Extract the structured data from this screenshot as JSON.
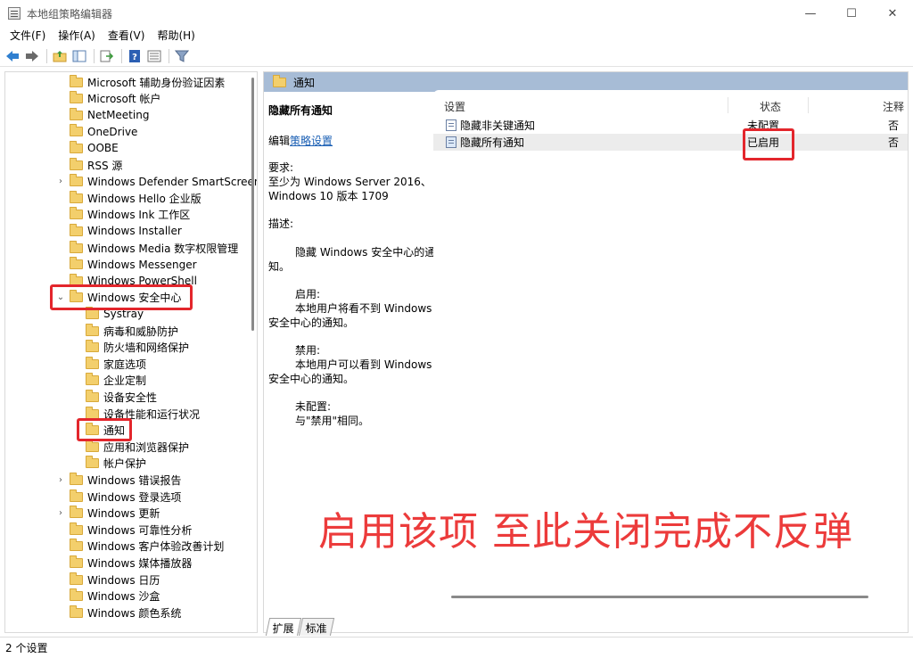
{
  "window": {
    "title": "本地组策略编辑器",
    "controls": {
      "minimize": "—",
      "maximize": "☐",
      "close": "✕"
    }
  },
  "menu": [
    "文件(F)",
    "操作(A)",
    "查看(V)",
    "帮助(H)"
  ],
  "toolbar": {
    "buttons": [
      "back-icon",
      "forward-icon",
      "up-folder-icon",
      "show-hide-tree-icon",
      "export-list-icon",
      "help-icon",
      "properties-icon",
      "filter-icon"
    ]
  },
  "tree": {
    "items": [
      {
        "label": "Microsoft 辅助身份验证因素",
        "level": 1,
        "chevron": ""
      },
      {
        "label": "Microsoft 帐户",
        "level": 1,
        "chevron": ""
      },
      {
        "label": "NetMeeting",
        "level": 1,
        "chevron": ""
      },
      {
        "label": "OneDrive",
        "level": 1,
        "chevron": ""
      },
      {
        "label": "OOBE",
        "level": 1,
        "chevron": ""
      },
      {
        "label": "RSS 源",
        "level": 1,
        "chevron": ""
      },
      {
        "label": "Windows Defender SmartScreen",
        "level": 1,
        "chevron": "›"
      },
      {
        "label": "Windows Hello 企业版",
        "level": 1,
        "chevron": ""
      },
      {
        "label": "Windows Ink 工作区",
        "level": 1,
        "chevron": ""
      },
      {
        "label": "Windows Installer",
        "level": 1,
        "chevron": ""
      },
      {
        "label": "Windows Media 数字权限管理",
        "level": 1,
        "chevron": ""
      },
      {
        "label": "Windows Messenger",
        "level": 1,
        "chevron": ""
      },
      {
        "label": "Windows PowerShell",
        "level": 1,
        "chevron": ""
      },
      {
        "label": "Windows 安全中心",
        "level": 1,
        "chevron": "⌄"
      },
      {
        "label": "Systray",
        "level": 2,
        "chevron": ""
      },
      {
        "label": "病毒和威胁防护",
        "level": 2,
        "chevron": ""
      },
      {
        "label": "防火墙和网络保护",
        "level": 2,
        "chevron": ""
      },
      {
        "label": "家庭选项",
        "level": 2,
        "chevron": ""
      },
      {
        "label": "企业定制",
        "level": 2,
        "chevron": ""
      },
      {
        "label": "设备安全性",
        "level": 2,
        "chevron": ""
      },
      {
        "label": "设备性能和运行状况",
        "level": 2,
        "chevron": ""
      },
      {
        "label": "通知",
        "level": 2,
        "chevron": ""
      },
      {
        "label": "应用和浏览器保护",
        "level": 2,
        "chevron": ""
      },
      {
        "label": "帐户保护",
        "level": 2,
        "chevron": ""
      },
      {
        "label": "Windows 错误报告",
        "level": 1,
        "chevron": "›"
      },
      {
        "label": "Windows 登录选项",
        "level": 1,
        "chevron": ""
      },
      {
        "label": "Windows 更新",
        "level": 1,
        "chevron": "›"
      },
      {
        "label": "Windows 可靠性分析",
        "level": 1,
        "chevron": ""
      },
      {
        "label": "Windows 客户体验改善计划",
        "level": 1,
        "chevron": ""
      },
      {
        "label": "Windows 媒体播放器",
        "level": 1,
        "chevron": ""
      },
      {
        "label": "Windows 日历",
        "level": 1,
        "chevron": ""
      },
      {
        "label": "Windows 沙盒",
        "level": 1,
        "chevron": ""
      },
      {
        "label": "Windows 颜色系统",
        "level": 1,
        "chevron": ""
      }
    ]
  },
  "right": {
    "header_title": "通知",
    "policy_title": "隐藏所有通知",
    "edit_prefix": "编辑",
    "edit_link": "策略设置",
    "desc": {
      "req_label": "要求:",
      "req_text": "至少为 Windows Server 2016、Windows 10 版本 1709",
      "desc_label": "描述:",
      "desc_text": "隐藏 Windows 安全中心的通知。",
      "enabled_label": "启用:",
      "enabled_text": "本地用户将看不到 Windows 安全中心的通知。",
      "disabled_label": "禁用:",
      "disabled_text": "本地用户可以看到 Windows 安全中心的通知。",
      "notconfigured_label": "未配置:",
      "notconfigured_text": "与\"禁用\"相同。"
    },
    "columns": {
      "setting": "设置",
      "state": "状态",
      "note": "注释"
    },
    "rows": [
      {
        "name": "隐藏非关键通知",
        "state": "未配置",
        "note": "否"
      },
      {
        "name": "隐藏所有通知",
        "state": "已启用",
        "note": "否"
      }
    ]
  },
  "tabs": [
    "扩展",
    "标准"
  ],
  "status": "2 个设置",
  "annotation": {
    "text": "启用该项  至此关闭完成不反弹",
    "color": "#ec3b3b",
    "box_color": "#e3262c"
  }
}
